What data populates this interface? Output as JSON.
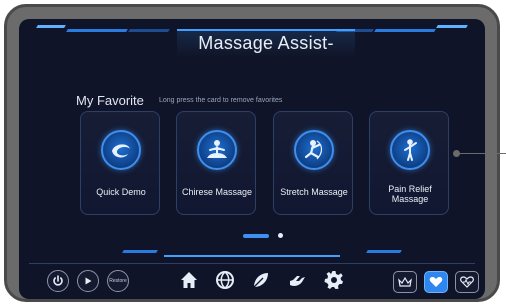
{
  "header": {
    "title": "Massage Assist-"
  },
  "favorites": {
    "title": "My Favorite",
    "hint": "Long press the card to remove favorites",
    "cards": [
      {
        "label": "Quick Demo",
        "icon": "swirl-icon"
      },
      {
        "label": "Chirese Massage",
        "icon": "meditation-icon"
      },
      {
        "label": "Stretch Massage",
        "icon": "stretch-icon"
      },
      {
        "label": "Pain Relief Massage",
        "icon": "pain-relief-icon"
      }
    ],
    "pager": {
      "pages": 2,
      "current": 1
    }
  },
  "bottom_bar": {
    "power_icon": "power-icon",
    "play_icon": "play-icon",
    "restore_label": "Restore",
    "nav_icons": [
      "home-icon",
      "globe-icon",
      "leaf-icon",
      "hand-icon",
      "gear-icon"
    ],
    "right_icons": [
      "crown-icon",
      "heart-icon",
      "heart-shield-icon"
    ],
    "active_right": "heart-icon"
  },
  "colors": {
    "background": "#101428",
    "accent": "#3d8ff0",
    "card_border": "#2e3f66",
    "text": "#e9eef7",
    "frame": "#6b6b6b"
  }
}
